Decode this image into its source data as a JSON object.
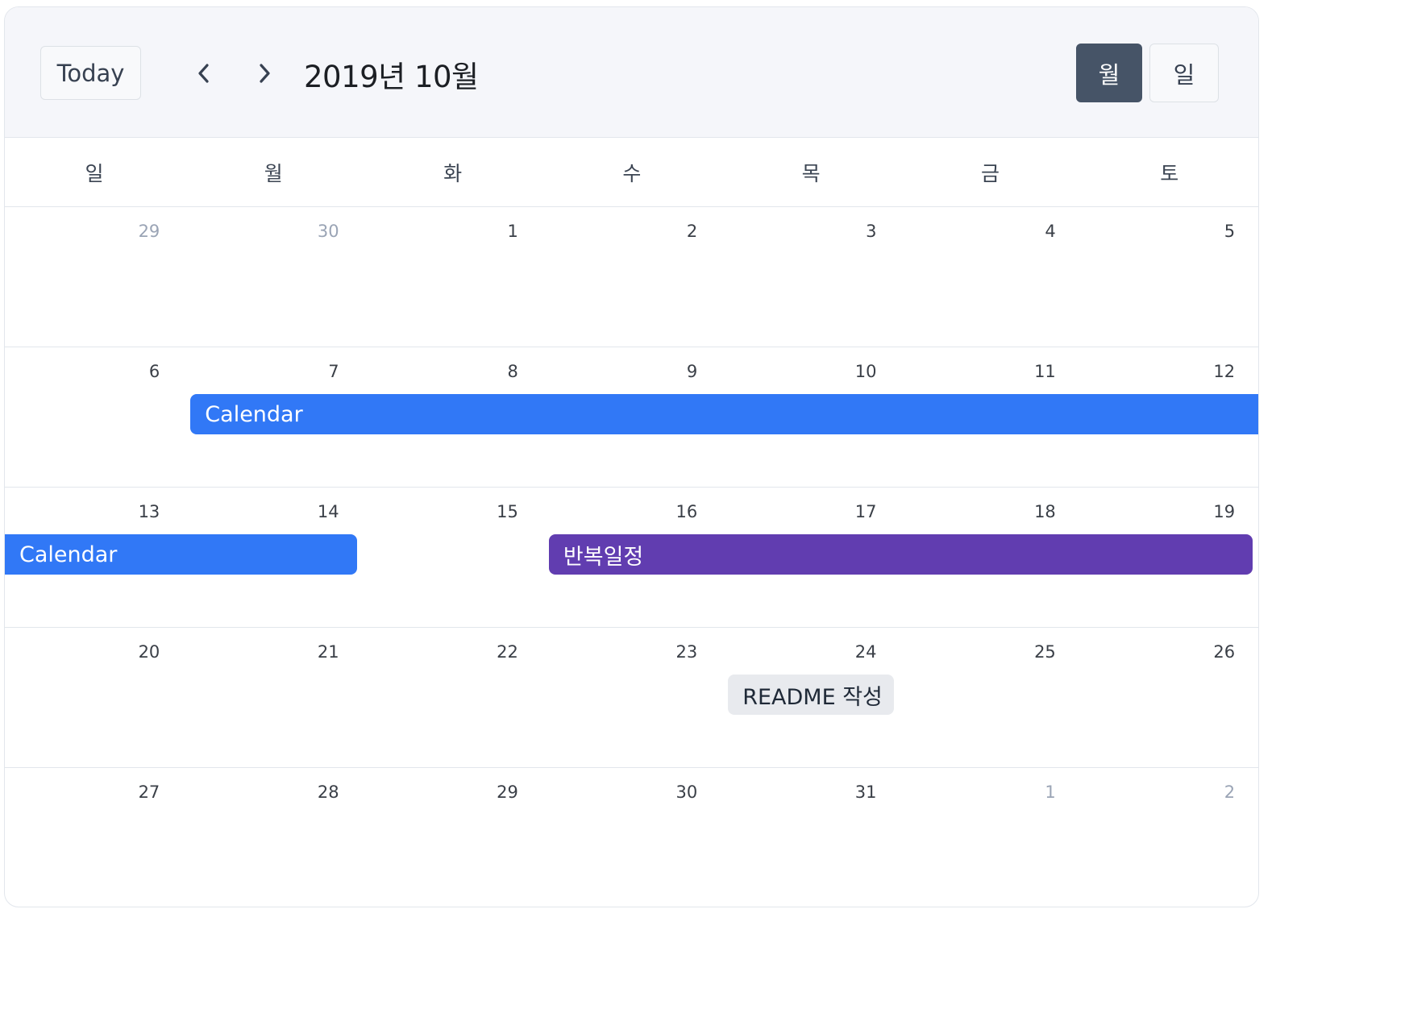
{
  "header": {
    "today_label": "Today",
    "title": "2019년 10월",
    "prev_icon": "chevron-left-icon",
    "next_icon": "chevron-right-icon",
    "view_month_label": "월",
    "view_day_label": "일",
    "active_view": "월"
  },
  "weekdays": [
    "일",
    "월",
    "화",
    "수",
    "목",
    "금",
    "토"
  ],
  "weeks": [
    [
      {
        "d": "29",
        "m": true
      },
      {
        "d": "30",
        "m": true
      },
      {
        "d": "1"
      },
      {
        "d": "2"
      },
      {
        "d": "3"
      },
      {
        "d": "4"
      },
      {
        "d": "5"
      }
    ],
    [
      {
        "d": "6"
      },
      {
        "d": "7"
      },
      {
        "d": "8"
      },
      {
        "d": "9"
      },
      {
        "d": "10"
      },
      {
        "d": "11"
      },
      {
        "d": "12"
      }
    ],
    [
      {
        "d": "13"
      },
      {
        "d": "14"
      },
      {
        "d": "15"
      },
      {
        "d": "16"
      },
      {
        "d": "17"
      },
      {
        "d": "18"
      },
      {
        "d": "19"
      }
    ],
    [
      {
        "d": "20"
      },
      {
        "d": "21"
      },
      {
        "d": "22"
      },
      {
        "d": "23"
      },
      {
        "d": "24"
      },
      {
        "d": "25"
      },
      {
        "d": "26"
      }
    ],
    [
      {
        "d": "27"
      },
      {
        "d": "28"
      },
      {
        "d": "29"
      },
      {
        "d": "30"
      },
      {
        "d": "31"
      },
      {
        "d": "1",
        "m": true
      },
      {
        "d": "2",
        "m": true
      }
    ]
  ],
  "events": [
    {
      "label": "Calendar",
      "week": 1,
      "start": 1,
      "end": 6,
      "cont_left": false,
      "cont_right": true,
      "bg": "#3178f6",
      "color": "#ffffff"
    },
    {
      "label": "Calendar",
      "week": 2,
      "start": 0,
      "end": 1,
      "cont_left": true,
      "cont_right": false,
      "bg": "#3178f6",
      "color": "#ffffff"
    },
    {
      "label": "반복일정",
      "week": 2,
      "start": 3,
      "end": 6,
      "cont_left": false,
      "cont_right": false,
      "bg": "#613db0",
      "color": "#ffffff"
    },
    {
      "label": "README 작성",
      "week": 3,
      "start": 4,
      "end": 4,
      "cont_left": false,
      "cont_right": false,
      "bg": "#e8eaee",
      "color": "#1f2937"
    }
  ],
  "colors": {
    "accent_blue": "#3178f6",
    "accent_purple": "#613db0",
    "active_view_bg": "#465467",
    "header_bg": "#f5f6fa"
  }
}
